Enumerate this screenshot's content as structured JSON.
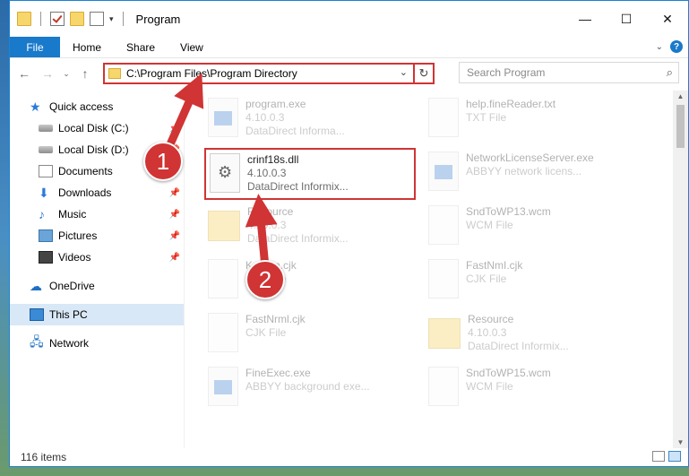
{
  "window": {
    "title": "Program",
    "controls": {
      "minimize": "—",
      "maximize": "☐",
      "close": "✕"
    }
  },
  "ribbon": {
    "tabs": [
      "File",
      "Home",
      "Share",
      "View"
    ]
  },
  "address": {
    "path": "C:\\Program Files\\Program Directory"
  },
  "search": {
    "placeholder": "Search Program"
  },
  "nav": {
    "items": [
      {
        "label": "Quick access",
        "icon": "star-icon"
      },
      {
        "label": "Local Disk (C:)",
        "icon": "disk-icon",
        "pinned": true
      },
      {
        "label": "Local Disk (D:)",
        "icon": "disk-icon",
        "pinned": true
      },
      {
        "label": "Documents",
        "icon": "documents-icon",
        "pinned": true
      },
      {
        "label": "Downloads",
        "icon": "download-icon",
        "pinned": true
      },
      {
        "label": "Music",
        "icon": "music-icon",
        "pinned": true
      },
      {
        "label": "Pictures",
        "icon": "pictures-icon",
        "pinned": true
      },
      {
        "label": "Videos",
        "icon": "videos-icon",
        "pinned": true
      },
      {
        "label": "OneDrive",
        "icon": "cloud-icon"
      },
      {
        "label": "This PC",
        "icon": "computer-icon",
        "selected": true
      },
      {
        "label": "Network",
        "icon": "network-icon"
      }
    ]
  },
  "files": [
    {
      "name": "program.exe",
      "sub1": "4.10.0.3",
      "sub2": "DataDirect Informa...",
      "icon": "exe",
      "faded": true
    },
    {
      "name": "help.fineReader.txt",
      "sub1": "TXT File",
      "sub2": "",
      "icon": "doc",
      "faded": true
    },
    {
      "name": "crinf18s.dll",
      "sub1": "4.10.0.3",
      "sub2": "DataDirect Informix...",
      "icon": "dll",
      "faded": false,
      "highlight": true
    },
    {
      "name": "NetworkLicenseServer.exe",
      "sub1": "ABBYY network licens...",
      "sub2": "",
      "icon": "exe",
      "faded": true
    },
    {
      "name": "Resource",
      "sub1": "4.10.0.3",
      "sub2": "DataDirect Informix...",
      "icon": "folder",
      "faded": true
    },
    {
      "name": "SndToWP13.wcm",
      "sub1": "WCM File",
      "sub2": "",
      "icon": "doc",
      "faded": true
    },
    {
      "name": "Korean.cjk",
      "sub1": "CJK File",
      "sub2": "",
      "icon": "doc",
      "faded": true
    },
    {
      "name": "FastNmI.cjk",
      "sub1": "CJK File",
      "sub2": "",
      "icon": "doc",
      "faded": true
    },
    {
      "name": "FastNrml.cjk",
      "sub1": "CJK File",
      "sub2": "",
      "icon": "doc",
      "faded": true
    },
    {
      "name": "Resource",
      "sub1": "4.10.0.3",
      "sub2": "DataDirect Informix...",
      "icon": "folder",
      "faded": true
    },
    {
      "name": "FineExec.exe",
      "sub1": "ABBYY background exe...",
      "sub2": "",
      "icon": "exe",
      "faded": true
    },
    {
      "name": "SndToWP15.wcm",
      "sub1": "WCM File",
      "sub2": "",
      "icon": "doc",
      "faded": true
    }
  ],
  "status": {
    "count": "116 items"
  },
  "annotations": {
    "step1": "1",
    "step2": "2",
    "color": "#d03434"
  }
}
